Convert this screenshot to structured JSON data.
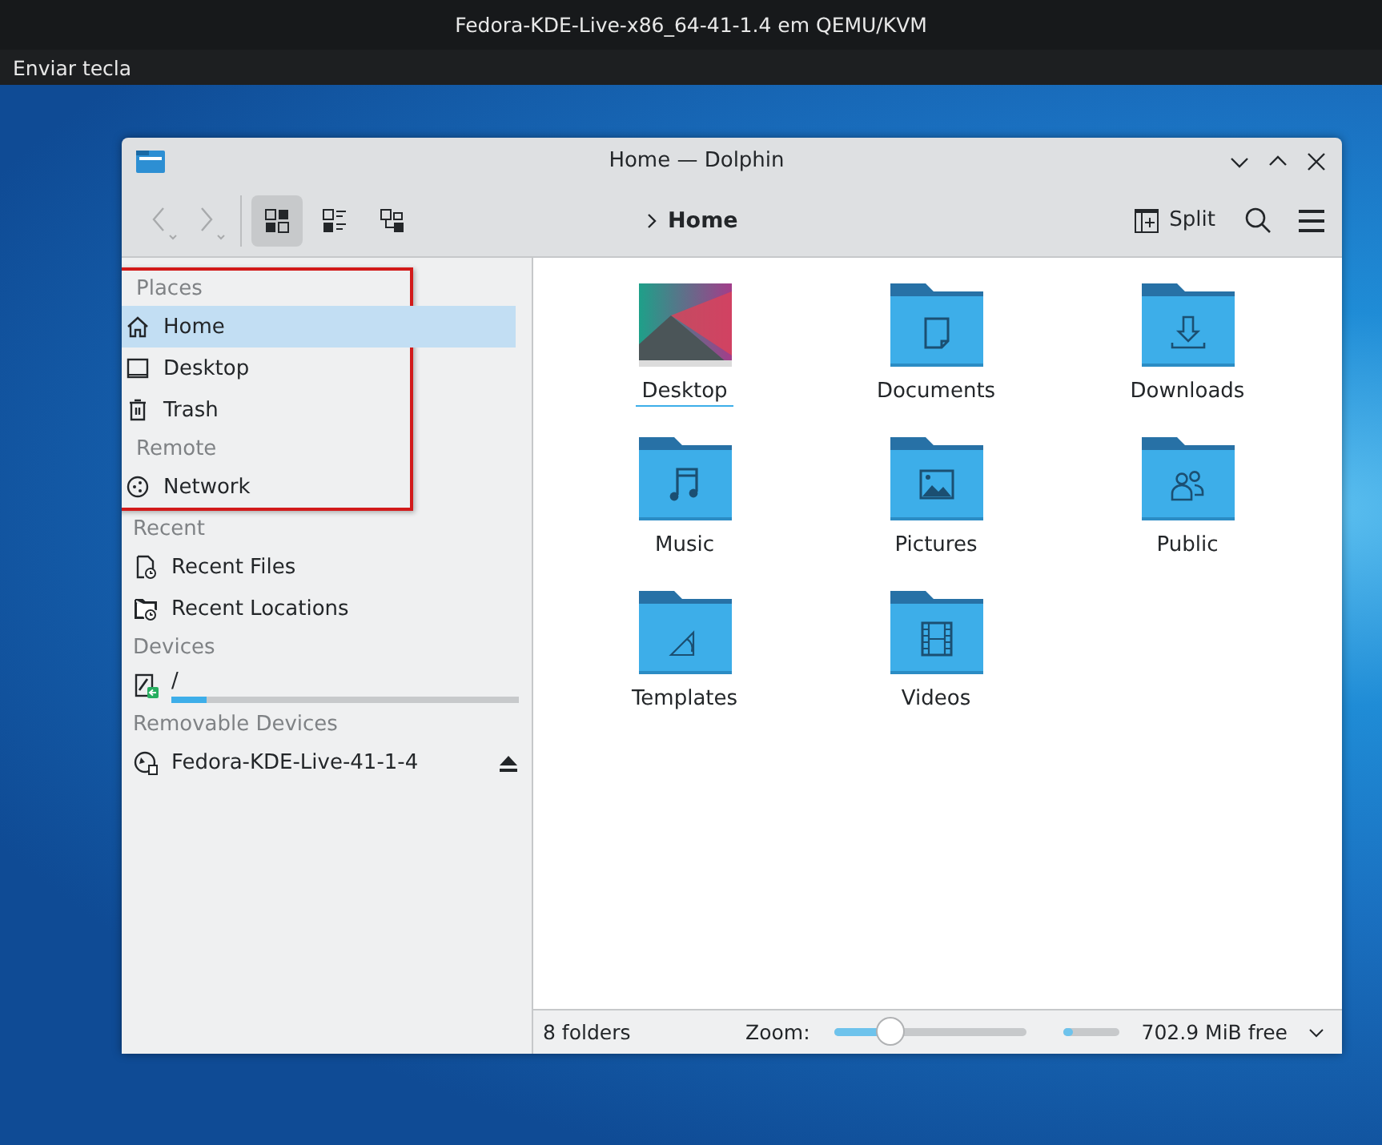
{
  "vm": {
    "title": "Fedora-KDE-Live-x86_64-41-1.4 em QEMU/KVM",
    "menu": [
      "Enviar tecla"
    ]
  },
  "window": {
    "title": "Home — Dolphin"
  },
  "toolbar": {
    "views": [
      {
        "kind": "icons",
        "selected": true
      },
      {
        "kind": "details",
        "selected": false
      },
      {
        "kind": "tree",
        "selected": false
      }
    ],
    "breadcrumb": "Home",
    "split": "Split"
  },
  "sidebar": [
    {
      "heading": "Places",
      "highlighted": true,
      "items": [
        {
          "kind": "home",
          "label": "Home",
          "selected": true
        },
        {
          "kind": "desktop",
          "label": "Desktop",
          "selected": false
        },
        {
          "kind": "trash",
          "label": "Trash",
          "selected": false
        }
      ]
    },
    {
      "heading": "Remote",
      "highlighted": true,
      "items": [
        {
          "kind": "network",
          "label": "Network",
          "selected": false
        }
      ]
    },
    {
      "heading": "Recent",
      "highlighted": false,
      "items": [
        {
          "kind": "recentfile",
          "label": "Recent Files",
          "selected": false
        },
        {
          "kind": "recentfolder",
          "label": "Recent Locations",
          "selected": false
        }
      ]
    },
    {
      "heading": "Devices",
      "highlighted": false,
      "items": [
        {
          "kind": "drive",
          "label": "/",
          "selected": false,
          "level": 0.1
        }
      ]
    },
    {
      "heading": "Removable Devices",
      "highlighted": false,
      "items": [
        {
          "kind": "disc",
          "label": "Fedora-KDE-Live-41-1-4",
          "selected": false,
          "eject": true
        }
      ]
    }
  ],
  "files": [
    {
      "kind": "thumbnail",
      "name": "Desktop",
      "focused": true
    },
    {
      "kind": "document",
      "name": "Documents",
      "focused": false
    },
    {
      "kind": "download",
      "name": "Downloads",
      "focused": false
    },
    {
      "kind": "music",
      "name": "Music",
      "focused": false
    },
    {
      "kind": "picture",
      "name": "Pictures",
      "focused": false
    },
    {
      "kind": "people",
      "name": "Public",
      "focused": false
    },
    {
      "kind": "template",
      "name": "Templates",
      "focused": false
    },
    {
      "kind": "film",
      "name": "Videos",
      "focused": false
    }
  ],
  "status_bar": {
    "summary": "8 folders",
    "zoom_label": "Zoom:",
    "zoom": {
      "level": 0.29
    },
    "space": {
      "level": 0.18
    },
    "free": "702.9 MiB free"
  }
}
